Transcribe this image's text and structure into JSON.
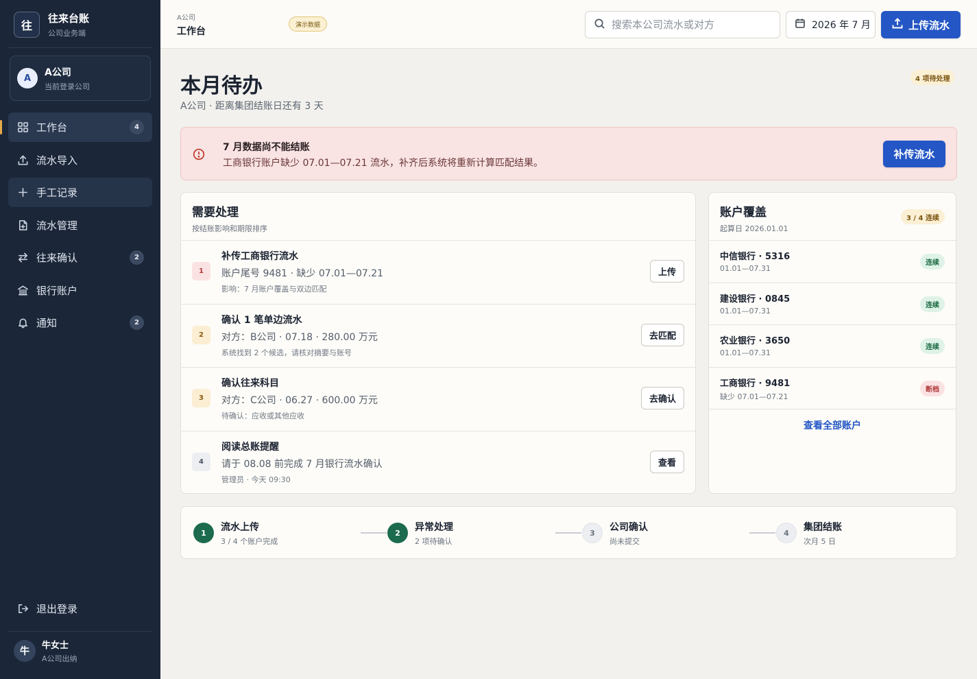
{
  "sidebar": {
    "brand_logo": "往",
    "brand_title": "往来台账",
    "brand_sub": "公司业务端",
    "company_avatar": "A",
    "company_name": "A公司",
    "company_sub": "当前登录公司",
    "items": [
      {
        "label": "工作台",
        "icon": "grid-icon",
        "badge": "4"
      },
      {
        "label": "流水导入",
        "icon": "upload-icon",
        "badge": ""
      },
      {
        "label": "手工记录",
        "icon": "plus-icon",
        "badge": ""
      },
      {
        "label": "流水管理",
        "icon": "file-icon",
        "badge": ""
      },
      {
        "label": "往来确认",
        "icon": "swap-icon",
        "badge": "2"
      },
      {
        "label": "银行账户",
        "icon": "bank-icon",
        "badge": ""
      },
      {
        "label": "通知",
        "icon": "bell-icon",
        "badge": "2"
      }
    ],
    "logout": "退出登录",
    "user_avatar": "牛",
    "user_name": "牛女士",
    "user_sub": "A公司出纳"
  },
  "topbar": {
    "crumb_small": "A公司",
    "crumb_title": "工作台",
    "demo_badge": "演示数据",
    "search_placeholder": "搜索本公司流水或对方",
    "month": "2026 年 7 月",
    "upload_label": "上传流水"
  },
  "main": {
    "title": "本月待办",
    "subtitle": "A公司 · 距离集团结账日还有 3 天",
    "pending_badge": "4 项待处理"
  },
  "alert": {
    "title": "7 月数据尚不能结账",
    "text": "工商银行账户缺少 07.01—07.21 流水，补齐后系统将重新计算匹配结果。",
    "button": "补传流水"
  },
  "tasks": {
    "title": "需要处理",
    "subtitle": "按结账影响和期限排序",
    "items": [
      {
        "num": "1",
        "title": "补传工商银行流水",
        "desc": "账户尾号 9481 · 缺少 07.01—07.21",
        "note": "影响：7 月账户覆盖与双边匹配",
        "button": "上传"
      },
      {
        "num": "2",
        "title": "确认 1 笔单边流水",
        "desc": "对方：B公司 · 07.18 · 280.00 万元",
        "note": "系统找到 2 个候选，请核对摘要与账号",
        "button": "去匹配"
      },
      {
        "num": "3",
        "title": "确认往来科目",
        "desc": "对方：C公司 · 06.27 · 600.00 万元",
        "note": "待确认：应收或其他应收",
        "button": "去确认"
      },
      {
        "num": "4",
        "title": "阅读总账提醒",
        "desc": "请于 08.08 前完成 7 月银行流水确认",
        "note": "管理员 · 今天 09:30",
        "button": "查看"
      }
    ]
  },
  "accounts": {
    "title": "账户覆盖",
    "subtitle": "起算日 2026.01.01",
    "badge": "3 / 4 连续",
    "items": [
      {
        "name": "中信银行 · 5316",
        "range": "01.01—07.31",
        "status": "连续"
      },
      {
        "name": "建设银行 · 0845",
        "range": "01.01—07.31",
        "status": "连续"
      },
      {
        "name": "农业银行 · 3650",
        "range": "01.01—07.31",
        "status": "连续"
      },
      {
        "name": "工商银行 · 9481",
        "range": "缺少 07.01—07.21",
        "status": "断档"
      }
    ],
    "view_all": "查看全部账户"
  },
  "steps": [
    {
      "num": "1",
      "title": "流水上传",
      "sub": "3 / 4 个账户完成",
      "state": "done"
    },
    {
      "num": "2",
      "title": "异常处理",
      "sub": "2 项待确认",
      "state": "done"
    },
    {
      "num": "3",
      "title": "公司确认",
      "sub": "尚未提交",
      "state": "todo"
    },
    {
      "num": "4",
      "title": "集团结账",
      "sub": "次月 5 日",
      "state": "todo"
    }
  ]
}
